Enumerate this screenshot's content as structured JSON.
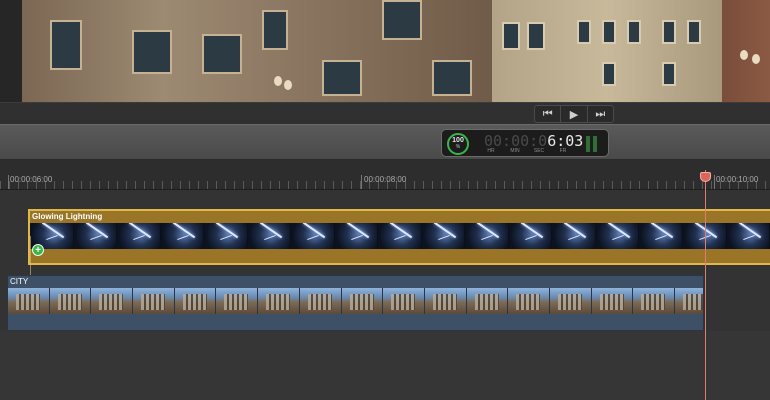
{
  "transport": {
    "prev_icon": "skip-back-icon",
    "play_icon": "play-icon",
    "next_icon": "skip-forward-icon",
    "prev_glyph": "⏮",
    "play_glyph": "▶",
    "next_glyph": "⏭"
  },
  "timecode": {
    "percent": "100",
    "percent_sub": "%",
    "dim_digits": "00:00:0",
    "bright_digits": "6:03",
    "units": [
      "HR",
      "MIN",
      "SEC",
      "FR"
    ]
  },
  "ruler": {
    "labels": [
      "00:00:06:00",
      "00:00:08:00",
      "00:00:10:00"
    ]
  },
  "clips": {
    "lightning_title": "Glowing Lightning",
    "city_title": "CITY"
  },
  "colors": {
    "lightning_clip": "#9a7427",
    "city_clip": "#3e5066",
    "playhead": "#e07d73",
    "timecode_ring": "#3db54a"
  }
}
